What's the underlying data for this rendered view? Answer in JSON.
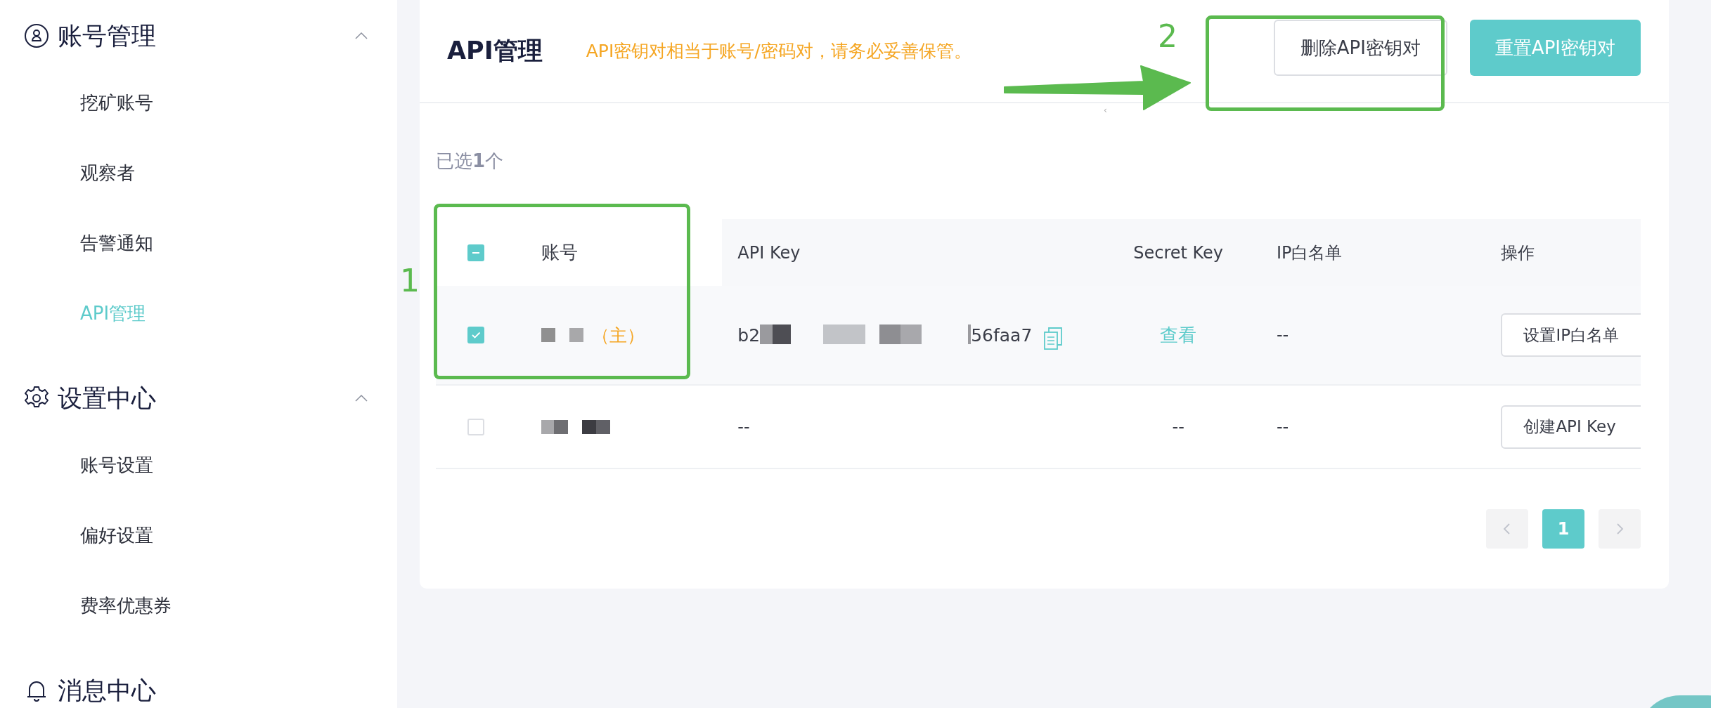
{
  "sidebar": {
    "groups": [
      {
        "title": "账号管理",
        "expanded": true,
        "items": [
          {
            "label": "挖矿账号",
            "selected": false
          },
          {
            "label": "观察者",
            "selected": false
          },
          {
            "label": "告警通知",
            "selected": false
          },
          {
            "label": "API管理",
            "selected": true
          }
        ]
      },
      {
        "title": "设置中心",
        "expanded": true,
        "items": [
          {
            "label": "账号设置",
            "selected": false
          },
          {
            "label": "偏好设置",
            "selected": false
          },
          {
            "label": "费率优惠券",
            "selected": false
          }
        ]
      },
      {
        "title": "消息中心"
      }
    ]
  },
  "header": {
    "title": "API管理",
    "note": "API密钥对相当于账号/密码对，请务必妥善保管。",
    "buttons": [
      {
        "label": "删除API密钥对",
        "kind": "secondary"
      },
      {
        "label": "重置API密钥对",
        "kind": "primary"
      }
    ]
  },
  "collapse_handle": "‹",
  "selection_note": "已选**1**个",
  "table": {
    "select_all_partial": true,
    "columns": [
      "账号",
      "API Key",
      "Secret Key",
      "IP白名单",
      "操作"
    ],
    "rows": [
      {
        "selected": true,
        "owner_tag": "（主）",
        "api_key_start": "b2",
        "api_key_end": "56faa7",
        "secret": {
          "kind": "link",
          "text": "查看"
        },
        "ip": "--",
        "action": "设置IP白名单"
      },
      {
        "selected": false,
        "api_key": "--",
        "secret": {
          "kind": "plain",
          "text": "--"
        },
        "ip": "--",
        "action": "创建API Key"
      }
    ]
  },
  "pagination": {
    "pages": [
      {
        "label": "1",
        "selected": true
      }
    ]
  },
  "annotations": [
    {
      "label": "1"
    },
    {
      "label": "2"
    }
  ]
}
